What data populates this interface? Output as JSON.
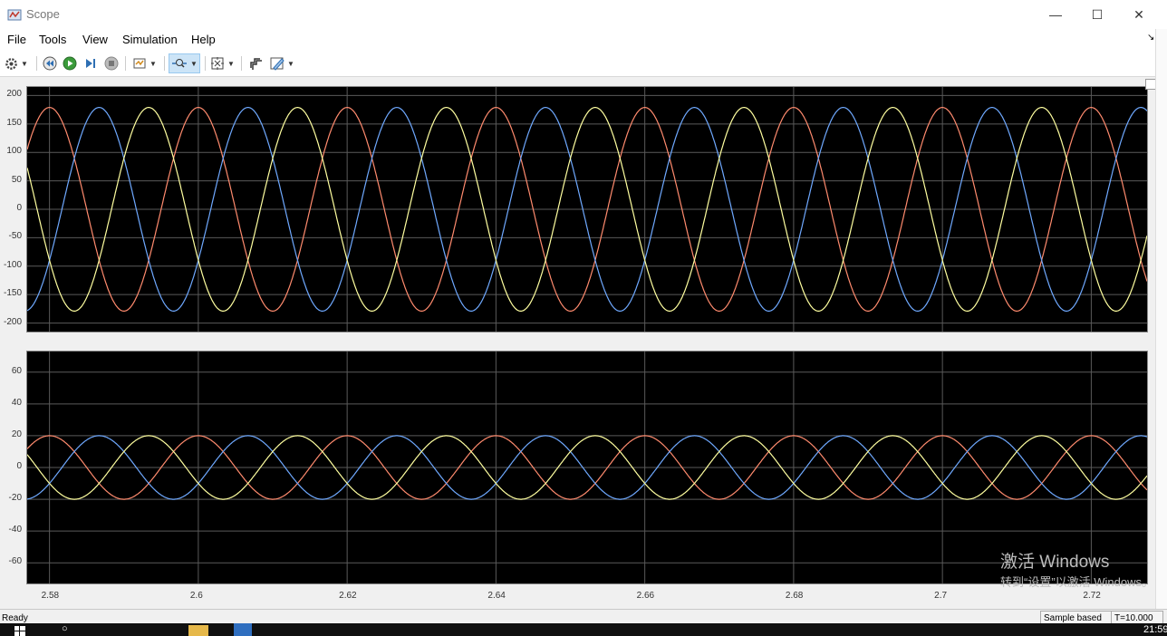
{
  "window": {
    "title": "Scope"
  },
  "menu": [
    "File",
    "Tools",
    "View",
    "Simulation",
    "Help"
  ],
  "toolbar": {
    "icons": [
      "gear-icon",
      "rewind-icon",
      "run-icon",
      "step-forward-icon",
      "stop-icon",
      "highlight-icon",
      "zoom-icon",
      "autoscale-icon",
      "cursor-icon",
      "style-icon"
    ]
  },
  "plot_top": {
    "yticks": [
      "200",
      "150",
      "100",
      "50",
      "0",
      "-50",
      "-100",
      "-150",
      "-200"
    ]
  },
  "plot_bottom": {
    "yticks": [
      "60",
      "40",
      "20",
      "0",
      "-20",
      "-40",
      "-60"
    ]
  },
  "xaxis": {
    "ticks": [
      "2.58",
      "2.6",
      "2.62",
      "2.64",
      "2.66",
      "2.68",
      "2.7",
      "2.72"
    ]
  },
  "status": {
    "text": "Ready",
    "mode": "Sample based",
    "time": "T=10.000"
  },
  "watermark": {
    "line1": "激活 Windows",
    "line2": "转到“设置”以激活 Windows。"
  },
  "taskbar": {
    "clock": "21:59"
  },
  "colors": {
    "phase_a": "#ff8b6e",
    "phase_b": "#6fa9ff",
    "phase_c": "#ffffa0",
    "grid": "#5a5a5a"
  },
  "chart_data": [
    {
      "type": "line",
      "title": "",
      "xlim": [
        2.577,
        2.7275
      ],
      "ylim": [
        -215,
        215
      ],
      "grid": true,
      "frequency_hz": 50,
      "series": [
        {
          "color": "#ff8b6e",
          "amplitude": 179,
          "phase_deg": 90
        },
        {
          "color": "#6fa9ff",
          "amplitude": 179,
          "phase_deg": -30
        },
        {
          "color": "#ffffa0",
          "amplitude": 179,
          "phase_deg": 210
        }
      ]
    },
    {
      "type": "line",
      "title": "",
      "xlim": [
        2.577,
        2.7275
      ],
      "ylim": [
        -73,
        73
      ],
      "grid": true,
      "frequency_hz": 50,
      "series": [
        {
          "color": "#ff8b6e",
          "amplitude": 20,
          "phase_deg": 90
        },
        {
          "color": "#6fa9ff",
          "amplitude": 20,
          "phase_deg": -30
        },
        {
          "color": "#ffffa0",
          "amplitude": 20,
          "phase_deg": 210
        }
      ]
    }
  ]
}
